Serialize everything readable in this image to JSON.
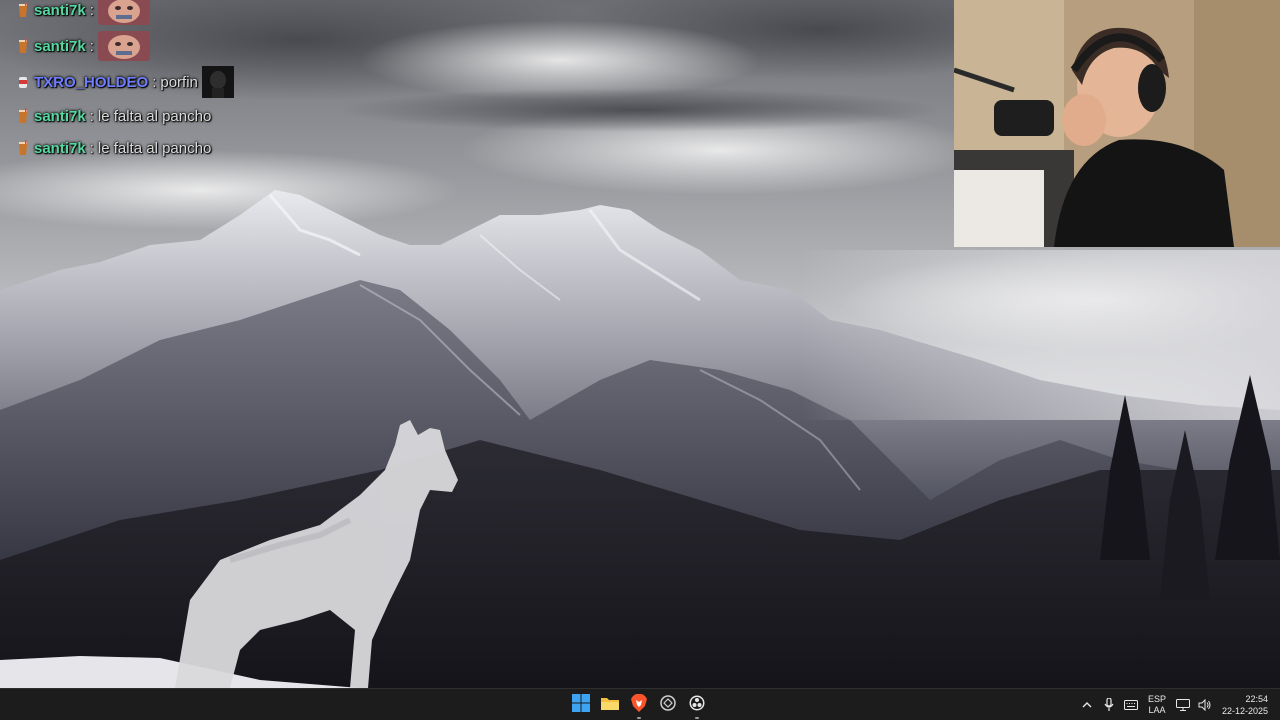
{
  "chat": {
    "messages": [
      {
        "user": "santi7k",
        "separator": ":",
        "text": "",
        "badge": "drink-badge-icon",
        "emote": "face-emote",
        "user_color": "#58d8a1"
      },
      {
        "user": "santi7k",
        "separator": ":",
        "text": "",
        "badge": "drink-badge-icon",
        "emote": "face-emote",
        "user_color": "#58d8a1"
      },
      {
        "user": "TXRO_HOLDEO",
        "separator": ":",
        "text": "porfin",
        "badge": "red-badge-icon",
        "emote": "dark-emote",
        "user_color": "#6f7dff"
      },
      {
        "user": "santi7k",
        "separator": ":",
        "text": "le falta al pancho",
        "badge": "drink-badge-icon",
        "user_color": "#58d8a1"
      },
      {
        "user": "santi7k",
        "separator": ":",
        "text": "le falta al pancho",
        "badge": "drink-badge-icon",
        "user_color": "#58d8a1"
      }
    ]
  },
  "taskbar": {
    "apps": [
      {
        "name": "start-button",
        "icon": "windows-icon",
        "active": false
      },
      {
        "name": "file-explorer-button",
        "icon": "folder-icon",
        "active": false
      },
      {
        "name": "brave-browser-button",
        "icon": "brave-lion-icon",
        "active": true
      },
      {
        "name": "app-circle-button",
        "icon": "circle-app-icon",
        "active": false
      },
      {
        "name": "obs-button",
        "icon": "obs-icon",
        "active": true
      }
    ],
    "tray": {
      "language_top": "ESP",
      "language_bottom": "LAA",
      "time": "22:54",
      "date": "22-12-2025"
    }
  },
  "colors": {
    "chat_user_green": "#58d8a1",
    "chat_user_blue": "#6f7dff",
    "taskbar_bg": "#1c1c1c"
  }
}
